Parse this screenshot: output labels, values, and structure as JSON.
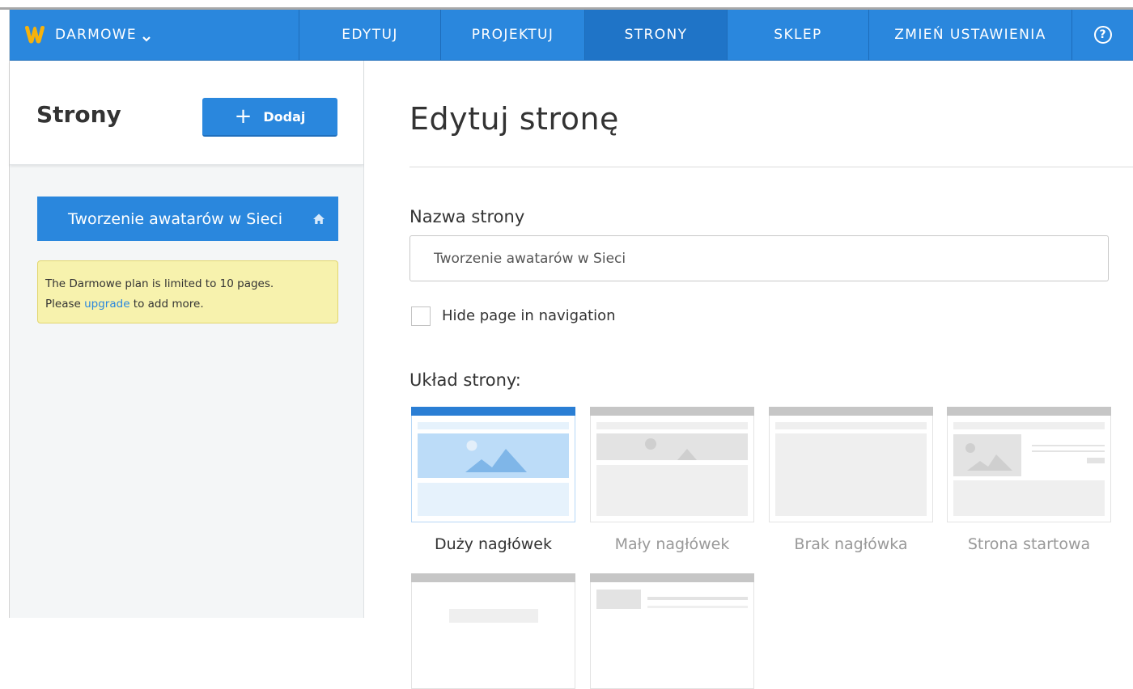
{
  "navbar": {
    "brand": "DARMOWE",
    "items": [
      {
        "label": "EDYTUJ",
        "active": false
      },
      {
        "label": "PROJEKTUJ",
        "active": false
      },
      {
        "label": "STRONY",
        "active": true
      },
      {
        "label": "SKLEP",
        "active": false
      },
      {
        "label": "ZMIEŃ USTAWIENIA",
        "active": false
      }
    ],
    "help": "?"
  },
  "sidebar": {
    "title": "Strony",
    "add_label": "Dodaj",
    "pages": [
      {
        "label": "Tworzenie awatarów w Sieci",
        "is_home": true
      }
    ],
    "notice": {
      "line1": "The Darmowe plan is limited to 10 pages.",
      "before_link": "Please ",
      "link": "upgrade",
      "after_link": " to add more."
    }
  },
  "main": {
    "title": "Edytuj stronę",
    "name_label": "Nazwa strony",
    "name_value": "Tworzenie awatarów w Sieci",
    "hide_label": "Hide page in navigation",
    "hide_checked": false,
    "layout_label": "Układ strony:",
    "layouts": [
      {
        "label": "Duży nagłówek",
        "selected": true
      },
      {
        "label": "Mały nagłówek",
        "selected": false
      },
      {
        "label": "Brak nagłówka",
        "selected": false
      },
      {
        "label": "Strona startowa",
        "selected": false
      }
    ]
  },
  "colors": {
    "accent": "#2a87dd",
    "navbar": "#2a87dd",
    "notice_bg": "#f7f2ad",
    "sidebar_bg": "#f4f6f7"
  },
  "icons": {
    "brand": "weebly-w-logo",
    "dropdown": "chevron-down-icon",
    "help": "question-circle-icon",
    "home": "home-icon",
    "add": "plus-icon"
  }
}
